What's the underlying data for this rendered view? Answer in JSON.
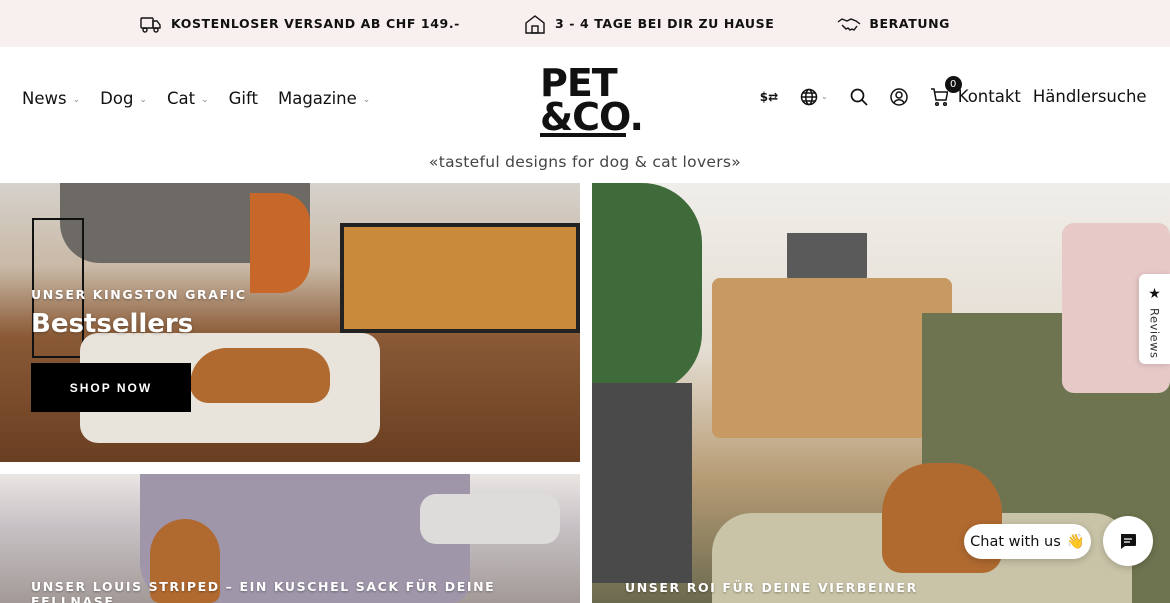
{
  "announcement": {
    "shipping": "KOSTENLOSER VERSAND AB CHF 149.-",
    "delivery": "3 - 4 TAGE BEI DIR ZU HAUSE",
    "advice": "BERATUNG"
  },
  "nav": {
    "items": [
      {
        "label": "News",
        "has_dropdown": true
      },
      {
        "label": "Dog",
        "has_dropdown": true
      },
      {
        "label": "Cat",
        "has_dropdown": true
      },
      {
        "label": "Gift",
        "has_dropdown": false
      },
      {
        "label": "Magazine",
        "has_dropdown": true
      }
    ]
  },
  "logo": {
    "line1": "PET",
    "line2": "&CO."
  },
  "tagline": "«tasteful designs for dog & cat lovers»",
  "header_tools": {
    "currency_icon": "$⇄",
    "cart_count": "0",
    "contact": "Kontakt",
    "dealer_search": "Händlersuche"
  },
  "tiles": {
    "kingston": {
      "eyebrow": "UNSER KINGSTON GRAFIC",
      "title": "Bestsellers",
      "button": "SHOP NOW"
    },
    "louis": {
      "eyebrow": "UNSER LOUIS STRIPED – EIN KUSCHEL SACK FÜR DEINE FELLNASE"
    },
    "roi": {
      "eyebrow": "UNSER ROI FÜR DEINE VIERBEINER"
    }
  },
  "reviews_tab": {
    "label": "Reviews"
  },
  "chat": {
    "label": "Chat with us",
    "emoji": "👋"
  },
  "colors": {
    "announcement_bg": "#f8f0ee",
    "button_bg": "#000000",
    "text": "#111111"
  }
}
